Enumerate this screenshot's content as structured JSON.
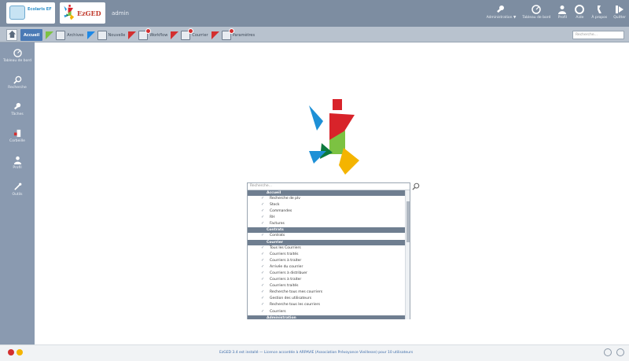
{
  "header": {
    "logo_text": "Ecolaris EF",
    "app_name": "EzGED",
    "user": "admin",
    "actions": [
      {
        "id": "administration",
        "label": "Administration ▼",
        "icon": "wrench-icon"
      },
      {
        "id": "dashboard",
        "label": "Tableau de bord",
        "icon": "gauge-icon"
      },
      {
        "id": "profile",
        "label": "Profil",
        "icon": "user-icon"
      },
      {
        "id": "help",
        "label": "Aide",
        "icon": "lifebuoy-icon"
      },
      {
        "id": "about",
        "label": "À propos",
        "icon": "about-icon"
      },
      {
        "id": "quit",
        "label": "Quitter",
        "icon": "logout-icon"
      }
    ]
  },
  "tabs": {
    "items": [
      {
        "id": "accueil",
        "label": "Accueil",
        "active": true
      },
      {
        "id": "archives",
        "label": "Archives",
        "flag_color": "#7cc242",
        "badge": false
      },
      {
        "id": "nouvelle",
        "label": "Nouvelle",
        "flag_color": "#1e88e5",
        "badge": false
      },
      {
        "id": "workflow",
        "label": "Workflow",
        "flag_color": "#d32f2f",
        "badge": true
      },
      {
        "id": "courrier",
        "label": "Courrier",
        "flag_color": "#d32f2f",
        "badge": true
      },
      {
        "id": "parametres",
        "label": "Paramètres",
        "flag_color": "#d32f2f",
        "badge": true
      }
    ],
    "search_placeholder": "Recherche..."
  },
  "sidebar": {
    "items": [
      {
        "id": "tableau",
        "label": "Tableau de bord",
        "icon": "gauge-icon"
      },
      {
        "id": "recherche",
        "label": "Recherche",
        "icon": "search-icon"
      },
      {
        "id": "taches",
        "label": "Tâches",
        "icon": "tasks-icon"
      },
      {
        "id": "corbeille",
        "label": "Corbeille",
        "icon": "trash-icon"
      },
      {
        "id": "profil",
        "label": "Profil",
        "icon": "user-icon"
      },
      {
        "id": "outils",
        "label": "Outils",
        "icon": "tools-icon"
      }
    ]
  },
  "dropdown": {
    "placeholder": "Recherche...",
    "groups": [
      {
        "title": "Accueil",
        "items": [
          "Recherche de plv",
          "Stock",
          "Commandes",
          "RH",
          "Factures"
        ]
      },
      {
        "title": "Contrats",
        "items": [
          "Contrats"
        ]
      },
      {
        "title": "Courrier",
        "items": [
          "Tous les Courriers",
          "Courriers traités",
          "Courriers à traiter",
          "Arrivée du courrier",
          "Courriers à distribuer",
          "Courriers à traiter",
          "Courriers traités",
          "Recherche tous mes courriers",
          "Gestion des utilisateurs",
          "Recherche tous les courriers",
          "Courriers"
        ]
      },
      {
        "title": "Administration",
        "items": []
      }
    ]
  },
  "footer": {
    "message": "EzGED 3.4 est installé — Licence accordée à ARPAVIE (Association Prévoyance Vieillesse) pour 10 utilisateurs"
  },
  "colors": {
    "header_bg": "#7d8da1",
    "sidebar_bg": "#8a9ab0",
    "tabbar_bg": "#b8c2ce",
    "active_tab": "#4a7ab5"
  }
}
